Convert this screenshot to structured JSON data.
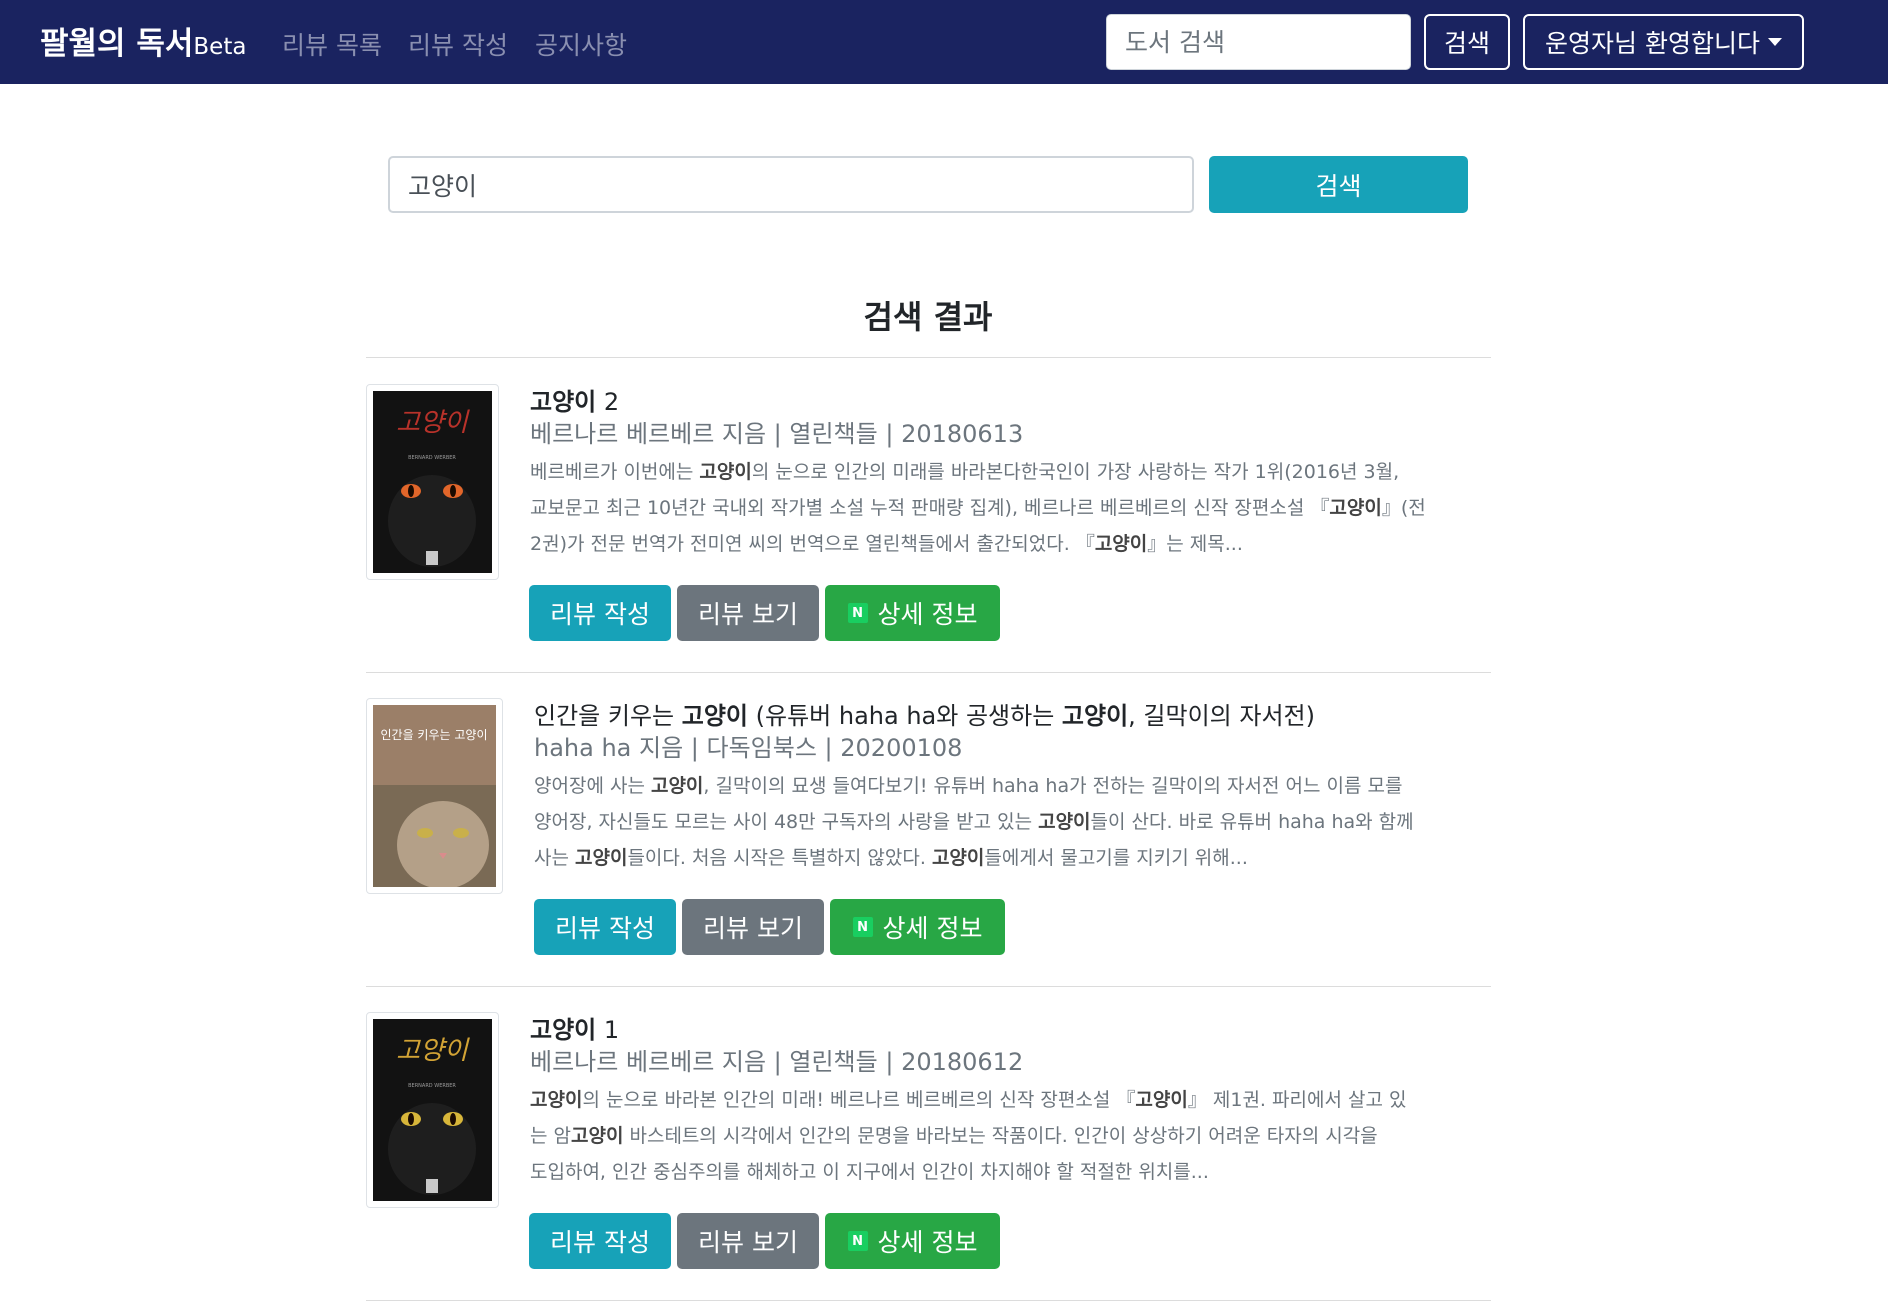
{
  "navbar": {
    "brand": "팔월의 독서",
    "brand_suffix": "Beta",
    "links": [
      "리뷰 목록",
      "리뷰 작성",
      "공지사항"
    ],
    "search_placeholder": "도서 검색",
    "search_button": "검색",
    "user_menu": "운영자님 환영합니다"
  },
  "search": {
    "value": "고양이",
    "button": "검색"
  },
  "results_title": "검색 결과",
  "colors": {
    "navbar": "#1a2360",
    "info": "#17a2b8",
    "secondary": "#6c757d",
    "success": "#28a745",
    "naver": "#19ce60"
  },
  "buttons": {
    "write_review": "리뷰 작성",
    "view_review": "리뷰 보기",
    "detail": "상세 정보",
    "detail_icon": "naver-icon",
    "detail_icon_text": "N"
  },
  "results": [
    {
      "title_parts": [
        {
          "t": "고양이",
          "b": true
        },
        {
          "t": " 2",
          "b": false
        }
      ],
      "meta": "베르나르 베르베르 지음 | 열린책들 | 20180613",
      "desc_lines": [
        [
          {
            "t": "베르베르가 이번에는 ",
            "b": false
          },
          {
            "t": "고양이",
            "b": true
          },
          {
            "t": "의 눈으로 인간의 미래를 바라본다한국인이 가장 사랑하는 작가 1위(2016년 3월,",
            "b": false
          }
        ],
        [
          {
            "t": "교보문고 최근 10년간 국내외 작가별 소설 누적 판매량 집계), 베르나르 베르베르의 신작 장편소설 『",
            "b": false
          },
          {
            "t": "고양이",
            "b": true
          },
          {
            "t": "』(전",
            "b": false
          }
        ],
        [
          {
            "t": "2권)가 전문 번역가 전미연 씨의 번역으로 열린책들에서 출간되었다. 『",
            "b": false
          },
          {
            "t": "고양이",
            "b": true
          },
          {
            "t": "』는 제목...",
            "b": false
          }
        ]
      ],
      "cover_title": "고양이",
      "cover_subtitle": "BERNARD WERBER"
    },
    {
      "title_parts": [
        {
          "t": "인간을 키우는 ",
          "b": false
        },
        {
          "t": "고양이",
          "b": true
        },
        {
          "t": " (유튜버 haha ha와 공생하는 ",
          "b": false
        },
        {
          "t": "고양이",
          "b": true
        },
        {
          "t": ", 길막이의 자서전)",
          "b": false
        }
      ],
      "meta": "haha ha 지음 | 다독임북스 | 20200108",
      "desc_lines": [
        [
          {
            "t": "양어장에 사는 ",
            "b": false
          },
          {
            "t": "고양이",
            "b": true
          },
          {
            "t": ", 길막이의 묘생 들여다보기! 유튜버 haha ha가 전하는 길막이의 자서전 어느 이름 모를",
            "b": false
          }
        ],
        [
          {
            "t": "양어장, 자신들도 모르는 사이 48만 구독자의 사랑을 받고 있는 ",
            "b": false
          },
          {
            "t": "고양이",
            "b": true
          },
          {
            "t": "들이 산다. 바로 유튜버 haha ha와 함께",
            "b": false
          }
        ],
        [
          {
            "t": "사는 ",
            "b": false
          },
          {
            "t": "고양이",
            "b": true
          },
          {
            "t": "들이다. 처음 시작은 특별하지 않았다. ",
            "b": false
          },
          {
            "t": "고양이",
            "b": true
          },
          {
            "t": "들에게서 물고기를 지키기 위해...",
            "b": false
          }
        ]
      ],
      "cover_title": "인간을 키우는 고양이",
      "cover_subtitle": ""
    },
    {
      "title_parts": [
        {
          "t": "고양이",
          "b": true
        },
        {
          "t": " 1",
          "b": false
        }
      ],
      "meta": "베르나르 베르베르 지음 | 열린책들 | 20180612",
      "desc_lines": [
        [
          {
            "t": "고양이",
            "b": true
          },
          {
            "t": "의 눈으로 바라본 인간의 미래! 베르나르 베르베르의 신작 장편소설 『",
            "b": false
          },
          {
            "t": "고양이",
            "b": true
          },
          {
            "t": "』 제1권. 파리에서 살고 있",
            "b": false
          }
        ],
        [
          {
            "t": "는 암",
            "b": false
          },
          {
            "t": "고양이",
            "b": true
          },
          {
            "t": " 바스테트의 시각에서 인간의 문명을 바라보는 작품이다. 인간이 상상하기 어려운 타자의 시각을",
            "b": false
          }
        ],
        [
          {
            "t": "도입하여, 인간 중심주의를 해체하고 이 지구에서 인간이 차지해야 할 적절한 위치를...",
            "b": false
          }
        ]
      ],
      "cover_title": "고양이",
      "cover_subtitle": "BERNARD WERBER"
    }
  ]
}
